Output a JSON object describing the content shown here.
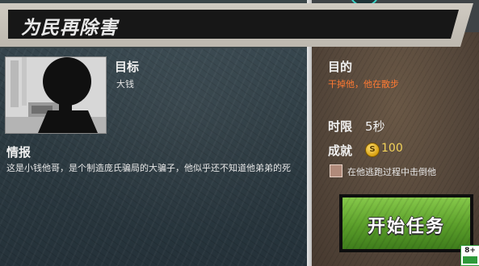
{
  "mission": {
    "title": "为民再除害"
  },
  "target": {
    "heading": "目标",
    "name": "大钱"
  },
  "intel": {
    "heading": "情报",
    "text": "这是小钱他哥，是个制造庞氏骗局的大骗子，他似乎还不知道他弟弟的死"
  },
  "objective": {
    "heading": "目的",
    "text": "干掉他，他在散步"
  },
  "time_limit": {
    "label": "时限",
    "value": "5秒"
  },
  "achievement": {
    "label": "成就",
    "coin_symbol": "S",
    "reward": "100",
    "condition": "在他逃跑过程中击倒他"
  },
  "start_button": {
    "label": "开始任务"
  },
  "age_rating": {
    "value": "8+"
  },
  "colors": {
    "objective_text": "#ff7a33",
    "start_button": "#5a9e2a",
    "reward_gold": "#f3d35a"
  }
}
